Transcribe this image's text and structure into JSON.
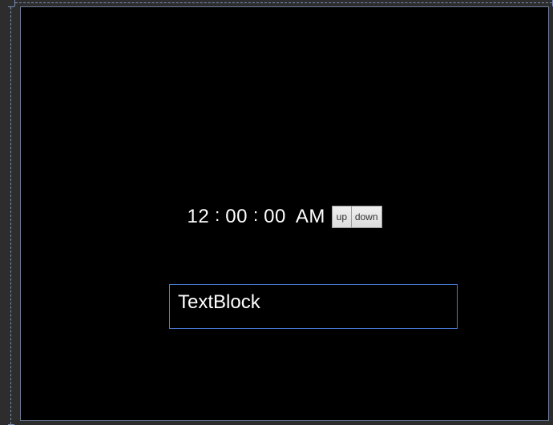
{
  "time": {
    "hours": "12",
    "sep": ":",
    "minutes": "00",
    "seconds": "00",
    "ampm": "AM",
    "up_label": "up",
    "down_label": "down"
  },
  "textblock": {
    "label": "TextBlock"
  }
}
